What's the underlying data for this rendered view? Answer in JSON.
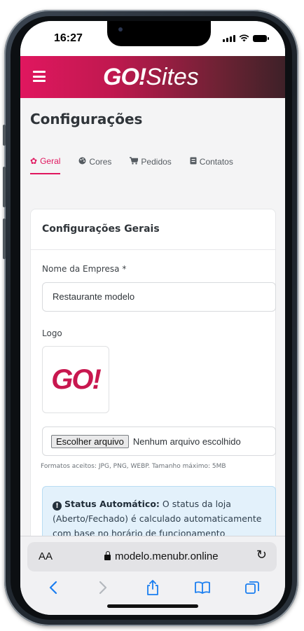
{
  "status_bar": {
    "time": "16:27"
  },
  "header": {
    "logo_bold": "GO!",
    "logo_light": "Sites"
  },
  "page": {
    "title": "Configurações"
  },
  "tabs": [
    {
      "label": "Geral",
      "icon": "gear-icon",
      "glyph": "✿",
      "active": true
    },
    {
      "label": "Cores",
      "icon": "palette-icon",
      "glyph": "🎨"
    },
    {
      "label": "Pedidos",
      "icon": "cart-icon",
      "glyph": "🛒"
    },
    {
      "label": "Contatos",
      "icon": "contact-card-icon",
      "glyph": "▣"
    }
  ],
  "card": {
    "title": "Configurações Gerais",
    "company_label": "Nome da Empresa *",
    "company_value": "Restaurante modelo",
    "logo_label": "Logo",
    "logo_preview_text": "GO!",
    "file_button": "Escolher arquivo",
    "file_status": "Nenhum arquivo escolhido",
    "file_hint": "Formatos aceitos: JPG, PNG, WEBP. Tamanho máximo: 5MB",
    "alert_title": "Status Automático:",
    "alert_text": "O status da loja (Aberto/Fechado) é calculado automaticamente com base no horário de funcionamento configurado abaixo."
  },
  "browser": {
    "aa_label": "AA",
    "url": "modelo.menubr.online"
  },
  "colors": {
    "brand": "#e0175f",
    "header_dark": "#3e2128",
    "ios_blue": "#1a7ef0"
  }
}
